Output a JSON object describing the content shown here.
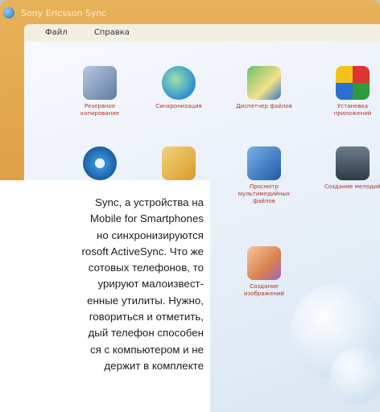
{
  "window": {
    "title": "Sony Ericsson Sync",
    "menu": [
      "Файл",
      "Справка"
    ]
  },
  "icons": [
    {
      "label": "Резервное копирование",
      "icon": "backup-icon"
    },
    {
      "label": "Синхронизация",
      "icon": "sync-icon"
    },
    {
      "label": "Диспетчер файлов",
      "icon": "file-manager-icon"
    },
    {
      "label": "Установка приложений",
      "icon": "install-apps-icon"
    },
    {
      "label": "",
      "icon": "cd-icon"
    },
    {
      "label": "",
      "icon": "contacts-icon"
    },
    {
      "label": "Просмотр мультимедийных файлов",
      "icon": "media-viewer-icon"
    },
    {
      "label": "Создание мелодий",
      "icon": "melody-maker-icon"
    },
    {
      "label": "Создание изображений",
      "icon": "image-maker-icon"
    }
  ],
  "article": {
    "lines": [
      "Sync, а устройства на",
      "Mobile for Smartphones",
      "но синхронизируются",
      "rosoft ActiveSync. Что же",
      "сотовых телефонов, то",
      "урируют малоизвест-",
      "енные утилиты. Нужно,",
      "говориться и отметить,",
      "дый телефон способен",
      "ся с компьютером и не",
      "держит в комплекте"
    ]
  }
}
